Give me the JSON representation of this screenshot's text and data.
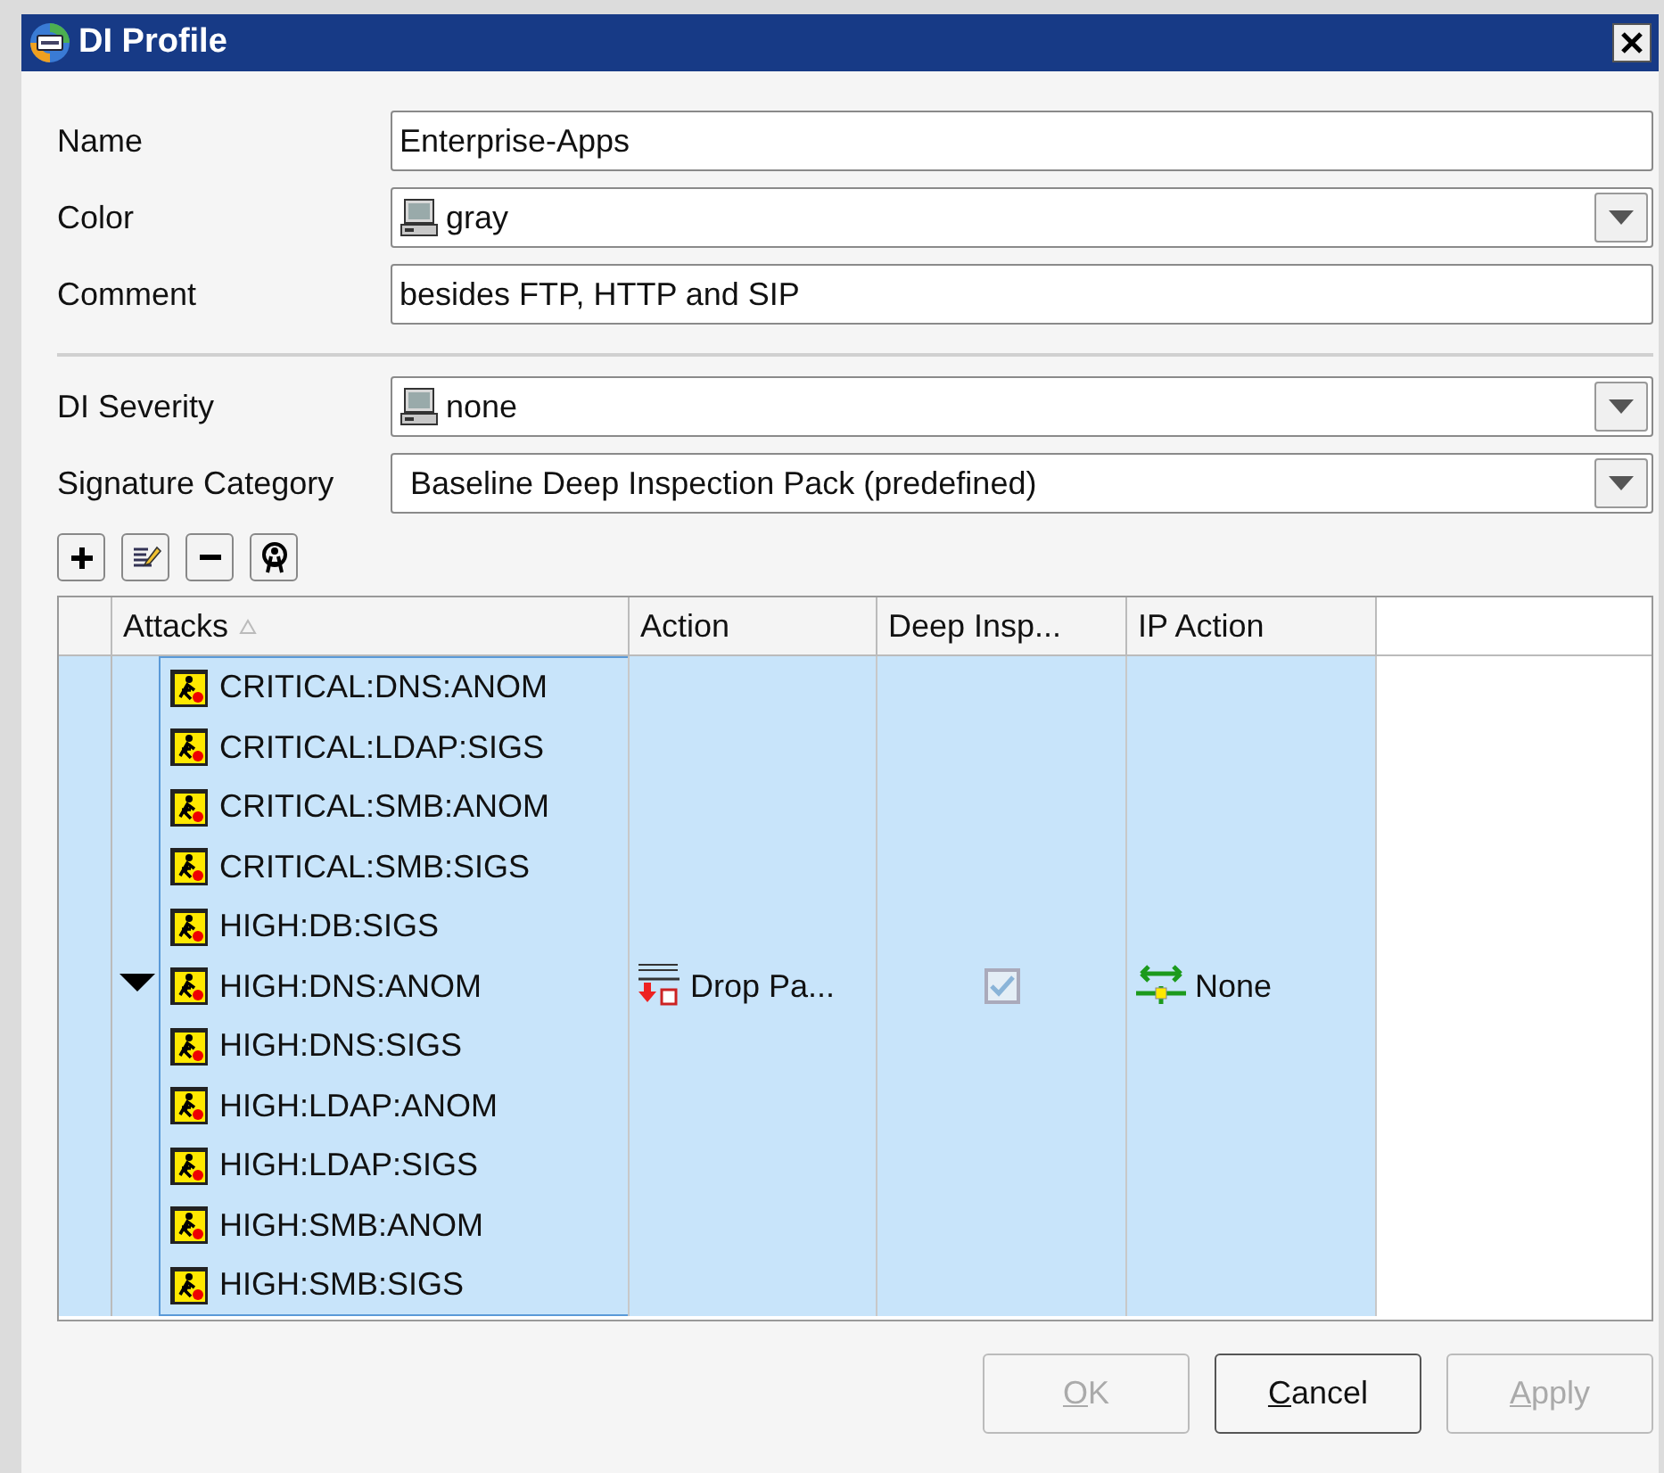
{
  "window": {
    "title": "DI Profile"
  },
  "general_fields": [
    {
      "label": "Name",
      "kind": "text",
      "value": "Enterprise-Apps"
    },
    {
      "label": "Color",
      "kind": "icon-dropdown",
      "value": "gray"
    },
    {
      "label": "Comment",
      "kind": "text",
      "value": "besides FTP, HTTP and SIP"
    }
  ],
  "inspection_fields": [
    {
      "label": "DI Severity",
      "kind": "icon-dropdown",
      "value": "none"
    },
    {
      "label": "Signature Category",
      "kind": "dropdown",
      "value": "Baseline Deep Inspection Pack  (predefined)"
    }
  ],
  "toolbar": [
    {
      "kind": "add"
    },
    {
      "kind": "edit"
    },
    {
      "kind": "remove"
    },
    {
      "kind": "find"
    }
  ],
  "table": {
    "columns": [
      {
        "label": "Attacks",
        "sorted": true
      },
      {
        "label": "Action",
        "sorted": false
      },
      {
        "label": "Deep Insp...",
        "sorted": false
      },
      {
        "label": "IP Action",
        "sorted": false
      }
    ],
    "rows": [
      {
        "selected": true,
        "expanded": true,
        "attacks": [
          "CRITICAL:DNS:ANOM",
          "CRITICAL:LDAP:SIGS",
          "CRITICAL:SMB:ANOM",
          "CRITICAL:SMB:SIGS",
          "HIGH:DB:SIGS",
          "HIGH:DNS:ANOM",
          "HIGH:DNS:SIGS",
          "HIGH:LDAP:ANOM",
          "HIGH:LDAP:SIGS",
          "HIGH:SMB:ANOM",
          "HIGH:SMB:SIGS"
        ],
        "action": "Drop Pa...",
        "deep_inspection": true,
        "ip_action": "None"
      }
    ]
  },
  "buttons": [
    {
      "label": "OK",
      "disabled": true
    },
    {
      "label": "Cancel",
      "disabled": false
    },
    {
      "label": "Apply",
      "disabled": true
    }
  ]
}
